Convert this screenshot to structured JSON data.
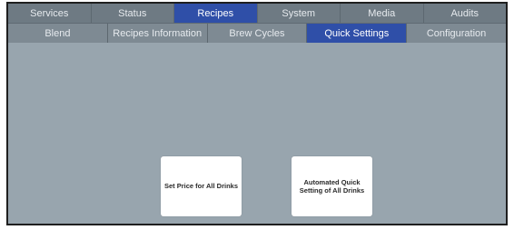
{
  "nav": {
    "primary_tabs": [
      {
        "label": "Services"
      },
      {
        "label": "Status"
      },
      {
        "label": "Recipes",
        "active": true
      },
      {
        "label": "System"
      },
      {
        "label": "Media"
      },
      {
        "label": "Audits"
      }
    ],
    "secondary_tabs": [
      {
        "label": "Blend"
      },
      {
        "label": "Recipes Information"
      },
      {
        "label": "Brew Cycles"
      },
      {
        "label": "Quick Settings",
        "active": true
      },
      {
        "label": "Configuration"
      }
    ]
  },
  "quick_settings": {
    "set_price_label": "Set Price for All Drinks",
    "automated_line1": "Automated Quick",
    "automated_line2": "Setting of All Drinks"
  },
  "colors": {
    "active_tab": "#2f4fa8",
    "background": "#98a5ae"
  }
}
